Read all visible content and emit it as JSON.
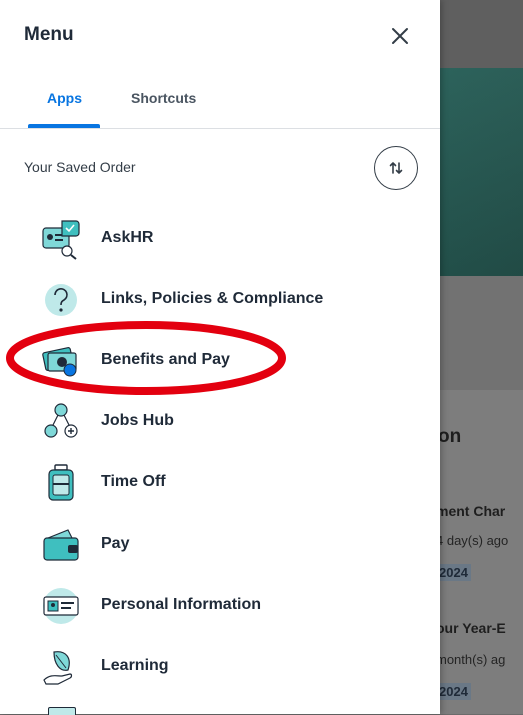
{
  "menu": {
    "title": "Menu",
    "tabs": [
      {
        "label": "Apps",
        "active": true
      },
      {
        "label": "Shortcuts",
        "active": false
      }
    ],
    "saved_order_label": "Your Saved Order",
    "apps": [
      {
        "label": "AskHR",
        "icon": "askhr-chat-icon"
      },
      {
        "label": "Links, Policies & Compliance",
        "icon": "question-mark-icon"
      },
      {
        "label": "Benefits and Pay",
        "icon": "money-icon",
        "highlighted": true
      },
      {
        "label": "Jobs Hub",
        "icon": "people-network-icon"
      },
      {
        "label": "Time Off",
        "icon": "luggage-icon"
      },
      {
        "label": "Pay",
        "icon": "wallet-icon"
      },
      {
        "label": "Personal Information",
        "icon": "id-card-icon"
      },
      {
        "label": "Learning",
        "icon": "hand-leaf-icon"
      }
    ]
  },
  "background": {
    "section_heading": "on",
    "items": [
      {
        "title": "ment Char",
        "meta": "4 day(s) ago",
        "date": "2024"
      },
      {
        "title": "our Year-E",
        "meta": "month(s) ag",
        "date": "2024"
      }
    ]
  },
  "colors": {
    "accent": "#0875e1",
    "highlight": "#e3000f",
    "text": "#1f2a38",
    "icon_teal": "#3fbfbf"
  }
}
